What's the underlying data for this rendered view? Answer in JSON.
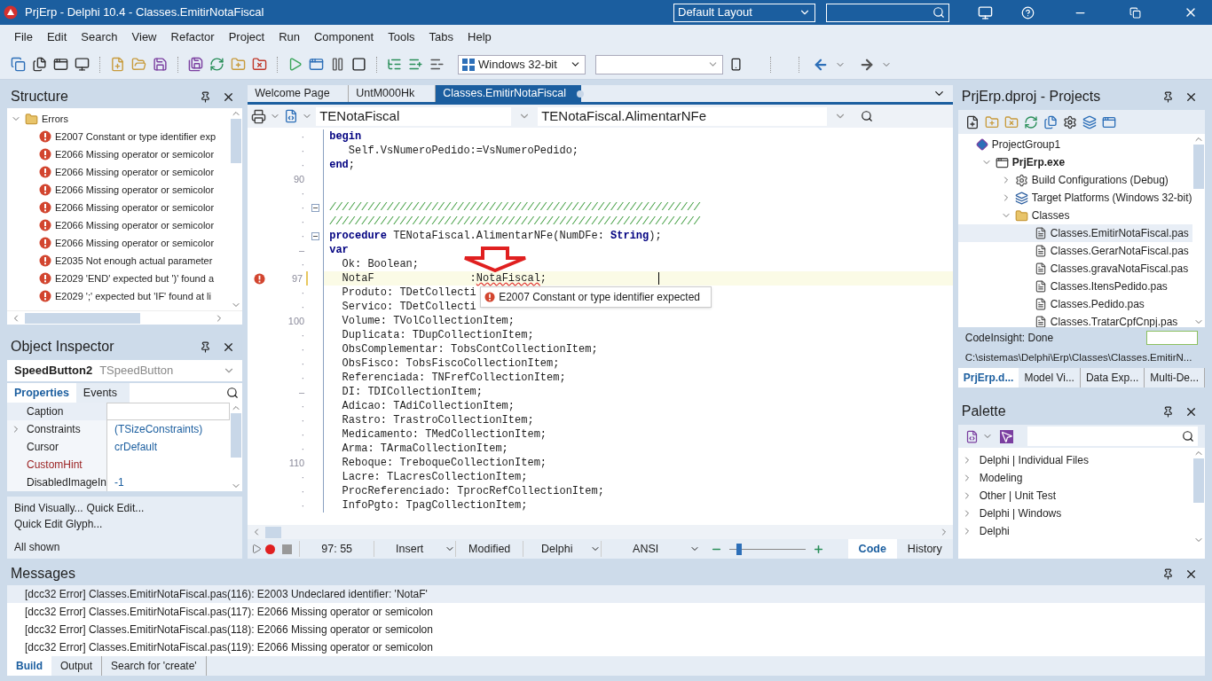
{
  "window": {
    "title": "PrjErp - Delphi 10.4 - Classes.EmitirNotaFiscal",
    "layout": "Default Layout"
  },
  "menu": [
    "File",
    "Edit",
    "Search",
    "View",
    "Refactor",
    "Project",
    "Run",
    "Component",
    "Tools",
    "Tabs",
    "Help"
  ],
  "toolbar": {
    "platform": "Windows 32-bit"
  },
  "structure": {
    "title": "Structure",
    "tree": [
      {
        "label": "Errors",
        "kind": "folder",
        "expanded": true,
        "children": [
          {
            "label": "E2007 Constant or type identifier exp",
            "kind": "error"
          },
          {
            "label": "E2066 Missing operator or semicolor",
            "kind": "error"
          },
          {
            "label": "E2066 Missing operator or semicolor",
            "kind": "error"
          },
          {
            "label": "E2066 Missing operator or semicolor",
            "kind": "error"
          },
          {
            "label": "E2066 Missing operator or semicolor",
            "kind": "error"
          },
          {
            "label": "E2066 Missing operator or semicolor",
            "kind": "error"
          },
          {
            "label": "E2066 Missing operator or semicolor",
            "kind": "error"
          },
          {
            "label": "E2035 Not enough actual parameter",
            "kind": "error"
          },
          {
            "label": "E2029 'END' expected but ')' found a",
            "kind": "error"
          },
          {
            "label": "E2029 ';' expected but 'IF' found at li",
            "kind": "error"
          }
        ]
      }
    ]
  },
  "object_inspector": {
    "title": "Object Inspector",
    "component": "SpeedButton2",
    "class": "TSpeedButton",
    "tabs": [
      {
        "label": "Properties",
        "selected": true
      },
      {
        "label": "Events",
        "selected": false
      }
    ],
    "properties": [
      {
        "name": "Caption",
        "kind": "plain",
        "selected": true
      },
      {
        "name": "Constraints",
        "value": "(TSizeConstraints)",
        "kind": "group",
        "selected": false
      },
      {
        "name": "Cursor",
        "value": "crDefault",
        "kind": "plain",
        "selected": false
      },
      {
        "name": "CustomHint",
        "kind": "reference",
        "selected": false
      },
      {
        "name": "DisabledImageIn",
        "value": "-1",
        "kind": "plain",
        "selected": false
      }
    ],
    "actions": [
      "Bind Visually...",
      "Quick Edit...",
      "Quick Edit Glyph..."
    ],
    "status": "All shown"
  },
  "editor": {
    "tabs": [
      {
        "label": "Welcome Page",
        "selected": false,
        "modified": false
      },
      {
        "label": "UntM000Hk",
        "selected": false,
        "modified": false
      },
      {
        "label": "Classes.EmitirNotaFiscal",
        "selected": true,
        "modified": true
      }
    ],
    "class_selector": "TENotaFiscal",
    "method_selector": "TENotaFiscal.AlimentarNFe",
    "lines": [
      {
        "gutter": "·",
        "fold": false,
        "error": false,
        "current": false,
        "segments": [
          {
            "text": "begin",
            "kind": "keyword"
          }
        ]
      },
      {
        "gutter": "·",
        "fold": false,
        "error": false,
        "current": false,
        "segments": [
          {
            "text": "   Self.VsNumeroPedido:=VsNumeroPedido;",
            "kind": "plain"
          }
        ]
      },
      {
        "gutter": "·",
        "fold": false,
        "error": false,
        "current": false,
        "segments": [
          {
            "text": "end",
            "kind": "keyword"
          },
          {
            "text": ";",
            "kind": "plain"
          }
        ]
      },
      {
        "gutter": "90",
        "fold": false,
        "error": false,
        "current": false
      },
      {
        "gutter": "·",
        "fold": false,
        "error": false,
        "current": false
      },
      {
        "gutter": "·",
        "fold": true,
        "error": false,
        "current": false,
        "segments": [
          {
            "text": "//////////////////////////////////////////////////////////",
            "kind": "comment"
          }
        ]
      },
      {
        "gutter": "·",
        "fold": false,
        "error": false,
        "current": false,
        "segments": [
          {
            "text": "//////////////////////////////////////////////////////////",
            "kind": "comment"
          }
        ]
      },
      {
        "gutter": "·",
        "fold": true,
        "error": false,
        "current": false,
        "segments": [
          {
            "text": "procedure",
            "kind": "keyword"
          },
          {
            "text": " TENotaFiscal.AlimentarNFe(NumDFe: ",
            "kind": "plain"
          },
          {
            "text": "String",
            "kind": "keyword"
          },
          {
            "text": ");",
            "kind": "plain"
          }
        ]
      },
      {
        "gutter": "–",
        "fold": false,
        "error": false,
        "current": false,
        "segments": [
          {
            "text": "var",
            "kind": "keyword"
          }
        ]
      },
      {
        "gutter": "·",
        "fold": false,
        "error": false,
        "current": false,
        "segments": [
          {
            "text": "  Ok: Boolean;",
            "kind": "plain"
          }
        ]
      },
      {
        "gutter": "97",
        "fold": false,
        "error": true,
        "current": true,
        "segments": [
          {
            "text": "  NotaF               :",
            "kind": "plain"
          },
          {
            "text": "NotaFiscal",
            "kind": "squiggle"
          },
          {
            "text": ";",
            "kind": "plain"
          }
        ]
      },
      {
        "gutter": "·",
        "fold": false,
        "error": false,
        "current": false,
        "segments": [
          {
            "text": "  Produto: TDetCollecti",
            "kind": "plain"
          }
        ]
      },
      {
        "gutter": "·",
        "fold": false,
        "error": false,
        "current": false,
        "segments": [
          {
            "text": "  Servico: TDetCollecti",
            "kind": "plain"
          }
        ]
      },
      {
        "gutter": "100",
        "fold": false,
        "error": false,
        "current": false,
        "segments": [
          {
            "text": "  Volume: TVolCollectionItem;",
            "kind": "plain"
          }
        ]
      },
      {
        "gutter": "·",
        "fold": false,
        "error": false,
        "current": false,
        "segments": [
          {
            "text": "  Duplicata: TDupCollectionItem;",
            "kind": "plain"
          }
        ]
      },
      {
        "gutter": "·",
        "fold": false,
        "error": false,
        "current": false,
        "segments": [
          {
            "text": "  ObsComplementar: TobsContCollectionItem;",
            "kind": "plain"
          }
        ]
      },
      {
        "gutter": "·",
        "fold": false,
        "error": false,
        "current": false,
        "segments": [
          {
            "text": "  ObsFisco: TobsFiscoCollectionItem;",
            "kind": "plain"
          }
        ]
      },
      {
        "gutter": "·",
        "fold": false,
        "error": false,
        "current": false,
        "segments": [
          {
            "text": "  Referenciada: TNFrefCollectionItem;",
            "kind": "plain"
          }
        ]
      },
      {
        "gutter": "–",
        "fold": false,
        "error": false,
        "current": false,
        "segments": [
          {
            "text": "  DI: TDICollectionItem;",
            "kind": "plain"
          }
        ]
      },
      {
        "gutter": "·",
        "fold": false,
        "error": false,
        "current": false,
        "segments": [
          {
            "text": "  Adicao: TAdiCollectionItem;",
            "kind": "plain"
          }
        ]
      },
      {
        "gutter": "·",
        "fold": false,
        "error": false,
        "current": false,
        "segments": [
          {
            "text": "  Rastro: TrastroCollectionItem;",
            "kind": "plain"
          }
        ]
      },
      {
        "gutter": "·",
        "fold": false,
        "error": false,
        "current": false,
        "segments": [
          {
            "text": "  Medicamento: TMedCollectionItem;",
            "kind": "plain"
          }
        ]
      },
      {
        "gutter": "·",
        "fold": false,
        "error": false,
        "current": false,
        "segments": [
          {
            "text": "  Arma: TArmaCollectionItem;",
            "kind": "plain"
          }
        ]
      },
      {
        "gutter": "110",
        "fold": false,
        "error": false,
        "current": false,
        "segments": [
          {
            "text": "  Reboque: TreboqueCollectionItem;",
            "kind": "plain"
          }
        ]
      },
      {
        "gutter": "·",
        "fold": false,
        "error": false,
        "current": false,
        "segments": [
          {
            "text": "  Lacre: TLacresCollectionItem;",
            "kind": "plain"
          }
        ]
      },
      {
        "gutter": "·",
        "fold": false,
        "error": false,
        "current": false,
        "segments": [
          {
            "text": "  ProcReferenciado: TprocRefCollectionItem;",
            "kind": "plain"
          }
        ]
      },
      {
        "gutter": "·",
        "fold": false,
        "error": false,
        "current": false,
        "segments": [
          {
            "text": "  InfoPgto: TpagCollectionItem;",
            "kind": "plain"
          }
        ]
      }
    ],
    "tooltip": "E2007 Constant or type identifier expected",
    "status": {
      "position": "97: 55",
      "mode": "Insert",
      "state": "Modified",
      "language": "Delphi",
      "encoding": "ANSI",
      "zoom": {
        "level": 0.12
      }
    },
    "view_tabs": [
      {
        "label": "Code",
        "selected": true
      },
      {
        "label": "History",
        "selected": false
      }
    ]
  },
  "projects": {
    "title": "PrjErp.dproj - Projects",
    "tree": [
      {
        "label": "ProjectGroup1",
        "kind": "group",
        "selected": false,
        "children": [
          {
            "label": "PrjErp.exe",
            "kind": "exe",
            "expanded": true,
            "selected": false,
            "children": [
              {
                "label": "Build Configurations (Debug)",
                "kind": "config",
                "expanded": false,
                "selected": false
              },
              {
                "label": "Target Platforms (Windows 32-bit)",
                "kind": "platform",
                "expanded": false,
                "selected": false
              },
              {
                "label": "Classes",
                "kind": "folder",
                "expanded": true,
                "selected": false,
                "children": [
                  {
                    "label": "Classes.EmitirNotaFiscal.pas",
                    "kind": "file",
                    "selected": true
                  },
                  {
                    "label": "Classes.GerarNotaFiscal.pas",
                    "kind": "file",
                    "selected": false
                  },
                  {
                    "label": "Classes.gravaNotaFiscal.pas",
                    "kind": "file",
                    "selected": false
                  },
                  {
                    "label": "Classes.ItensPedido.pas",
                    "kind": "file",
                    "selected": false
                  },
                  {
                    "label": "Classes.Pedido.pas",
                    "kind": "file",
                    "selected": false
                  },
                  {
                    "label": "Classes.TratarCpfCnpj.pas",
                    "kind": "file",
                    "selected": false
                  }
                ]
              }
            ]
          }
        ]
      }
    ],
    "status": "CodeInsight: Done",
    "path": "C:\\sistemas\\Delphi\\Erp\\Classes\\Classes.EmitirN...",
    "tabs": [
      {
        "label": "PrjErp.d...",
        "selected": true
      },
      {
        "label": "Model Vi...",
        "selected": false
      },
      {
        "label": "Data Exp...",
        "selected": false
      },
      {
        "label": "Multi-De...",
        "selected": false
      }
    ]
  },
  "palette": {
    "title": "Palette",
    "items": [
      "Delphi | Individual Files",
      "Modeling",
      "Other | Unit Test",
      "Delphi | Windows",
      "Delphi"
    ]
  },
  "messages": {
    "title": "Messages",
    "rows": [
      {
        "text": "[dcc32 Error] Classes.EmitirNotaFiscal.pas(116): E2003 Undeclared identifier: 'NotaF'",
        "selected": true
      },
      {
        "text": "[dcc32 Error] Classes.EmitirNotaFiscal.pas(117): E2066 Missing operator or semicolon",
        "selected": false
      },
      {
        "text": "[dcc32 Error] Classes.EmitirNotaFiscal.pas(118): E2066 Missing operator or semicolon",
        "selected": false
      },
      {
        "text": "[dcc32 Error] Classes.EmitirNotaFiscal.pas(119): E2066 Missing operator or semicolon",
        "selected": false
      }
    ],
    "tabs": [
      {
        "label": "Build",
        "selected": true
      },
      {
        "label": "Output",
        "selected": false
      },
      {
        "label": "Search for 'create'",
        "selected": false
      }
    ]
  }
}
